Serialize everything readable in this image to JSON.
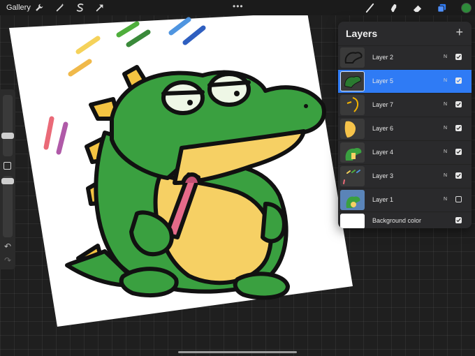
{
  "toolbar": {
    "gallery_label": "Gallery",
    "left_tools": [
      "wrench-icon",
      "magic-wand-icon",
      "selection-s-icon",
      "transform-arrow-icon"
    ],
    "more_label": "•••",
    "right_tools": [
      "brush-icon",
      "smudge-icon",
      "eraser-icon",
      "layers-icon"
    ],
    "active_color": "#2e8b3a"
  },
  "sidebar": {
    "undo_glyph": "↶",
    "redo_glyph": "↷"
  },
  "layers": {
    "title": "Layers",
    "add_glyph": "+",
    "items": [
      {
        "name": "Layer 2",
        "blend": "N",
        "visible": true,
        "active": false
      },
      {
        "name": "Layer 5",
        "blend": "N",
        "visible": true,
        "active": true
      },
      {
        "name": "Layer 7",
        "blend": "N",
        "visible": true,
        "active": false
      },
      {
        "name": "Layer 6",
        "blend": "N",
        "visible": true,
        "active": false
      },
      {
        "name": "Layer 4",
        "blend": "N",
        "visible": true,
        "active": false
      },
      {
        "name": "Layer 3",
        "blend": "N",
        "visible": true,
        "active": false
      },
      {
        "name": "Layer 1",
        "blend": "N",
        "visible": false,
        "active": false
      }
    ],
    "background": {
      "name": "Background color",
      "visible": true
    }
  },
  "colors": {
    "accent": "#2f7bf5",
    "croc_green": "#3aa040",
    "belly_yellow": "#f6d064",
    "spike_yellow": "#f4c442",
    "crayon_pink": "#e56a8a"
  }
}
